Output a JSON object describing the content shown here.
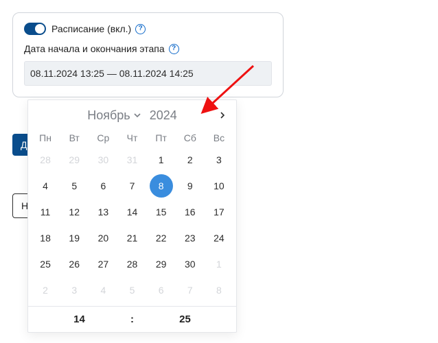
{
  "card": {
    "toggle_label": "Расписание (вкл.)",
    "range_label": "Дата начала и окончания этапа",
    "range_value": "08.11.2024 13:25 — 08.11.2024 14:25"
  },
  "buttons": {
    "primary_visible": "Д",
    "outline_visible": "Н"
  },
  "calendar": {
    "month": "Ноябрь",
    "year": "2024",
    "dow": [
      "Пн",
      "Вт",
      "Ср",
      "Чт",
      "Пт",
      "Сб",
      "Вс"
    ],
    "days": [
      {
        "n": 28,
        "out": true
      },
      {
        "n": 29,
        "out": true
      },
      {
        "n": 30,
        "out": true
      },
      {
        "n": 31,
        "out": true
      },
      {
        "n": 1
      },
      {
        "n": 2
      },
      {
        "n": 3
      },
      {
        "n": 4
      },
      {
        "n": 5
      },
      {
        "n": 6
      },
      {
        "n": 7
      },
      {
        "n": 8,
        "selected": true
      },
      {
        "n": 9
      },
      {
        "n": 10
      },
      {
        "n": 11
      },
      {
        "n": 12
      },
      {
        "n": 13
      },
      {
        "n": 14
      },
      {
        "n": 15
      },
      {
        "n": 16
      },
      {
        "n": 17
      },
      {
        "n": 18
      },
      {
        "n": 19
      },
      {
        "n": 20
      },
      {
        "n": 21
      },
      {
        "n": 22
      },
      {
        "n": 23
      },
      {
        "n": 24
      },
      {
        "n": 25
      },
      {
        "n": 26
      },
      {
        "n": 27
      },
      {
        "n": 28
      },
      {
        "n": 29
      },
      {
        "n": 30
      },
      {
        "n": 1,
        "out": true
      },
      {
        "n": 2,
        "out": true
      },
      {
        "n": 3,
        "out": true
      },
      {
        "n": 4,
        "out": true
      },
      {
        "n": 5,
        "out": true
      },
      {
        "n": 6,
        "out": true
      },
      {
        "n": 7,
        "out": true
      },
      {
        "n": 8,
        "out": true
      }
    ],
    "time": {
      "hour": "14",
      "minute": "25"
    }
  },
  "help_glyph": "?"
}
